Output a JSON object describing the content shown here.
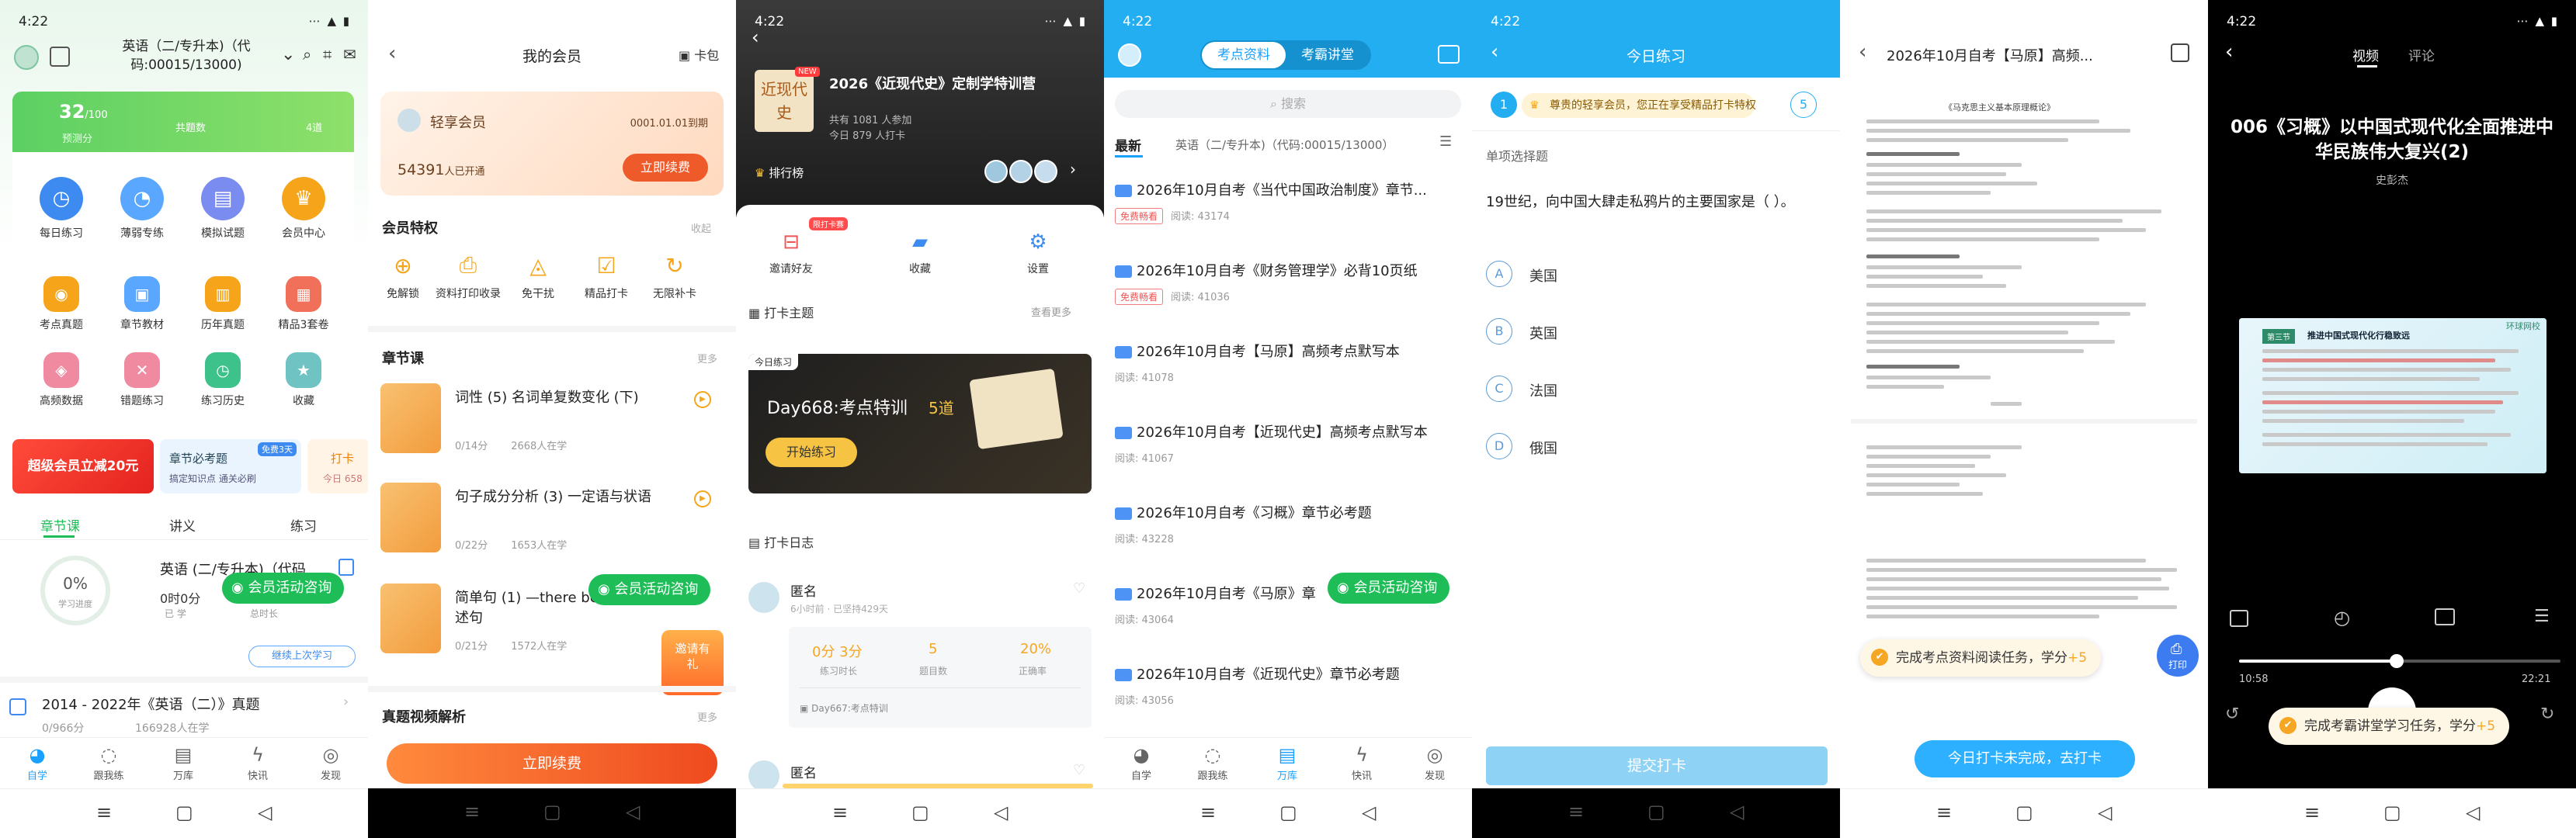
{
  "status_time": "4:22",
  "s1": {
    "title": "英语（二/专升本)（代码:00015/13000)",
    "score": "32",
    "score_sub": "/100",
    "score_lbl": "预测分",
    "c2": "共题数",
    "c3": "4道",
    "icons1": [
      "每日练习",
      "薄弱专练",
      "模拟试题",
      "会员中心"
    ],
    "icons2": [
      "考点真题",
      "章节教材",
      "历年真题",
      "精品3套卷"
    ],
    "icons3": [
      "高频数据",
      "错题练习",
      "练习历史",
      "收藏"
    ],
    "banner1": "超级会员立减20元",
    "banner2_t": "章节必考题",
    "banner2_s": "搞定知识点 通关必刷",
    "banner2_b": "免费3天",
    "banner3_t": "打卡",
    "banner3_s": "今日 658",
    "tabs": [
      "章节课",
      "讲义",
      "练习"
    ],
    "course_title": "英语 (二/专升本)（代码",
    "pct": "0%",
    "pct_lbl": "学习进度",
    "time_v": "0时0分",
    "time_l": "已 学",
    "total_l": "总时长",
    "continue": "继续上次学习",
    "item_title": "2014 - 2022年《英语（二）》真题",
    "item_meta1": "0/966分",
    "item_meta2": "166928人在学",
    "tab_items": [
      "自学",
      "跟我练",
      "万库",
      "快讯",
      "发现"
    ]
  },
  "s2": {
    "title": "我的会员",
    "card": "卡包",
    "member": "轻享会员",
    "expire": "0001.01.01到期",
    "count": "54391",
    "count_sfx": "人已开通",
    "renew": "立即续费",
    "priv_title": "会员特权",
    "priv_more": "收起",
    "privs": [
      "免解锁",
      "资料打印收录",
      "免干扰",
      "精品打卡",
      "无限补卡"
    ],
    "chap_title": "章节课",
    "chap_more": "更多",
    "lessons": [
      {
        "t": "词性 (5) 名词单复数变化 (下)",
        "a": "0/14分",
        "b": "2668人在学"
      },
      {
        "t": "句子成分分析 (3) 一定语与状语",
        "a": "0/22分",
        "b": "1653人在学"
      },
      {
        "t": "简单句 (1) —there be 述句",
        "a": "0/21分",
        "b": "1572人在学"
      }
    ],
    "gift": "邀请有礼",
    "video_title": "真题视频解析",
    "video_more": "更多",
    "btn": "立即续费"
  },
  "s3": {
    "badge": "NEW",
    "cover": "近现代史",
    "title": "2026《近现代史》定制学特训营",
    "joined": "共有 1081 人参加",
    "checked": "今日 879 人打卡",
    "rank": "排行榜",
    "acts": [
      "邀请好友",
      "收藏",
      "设置"
    ],
    "act_badge": "限打卡赛",
    "theme": "打卡主题",
    "theme_more": "查看更多",
    "card_tag": "今日练习",
    "card_title": "Day668:考点特训",
    "card_n": "5道",
    "card_btn": "开始练习",
    "log_title": "打卡日志",
    "u1": "匿名",
    "u1_sub": "6小时前 · 已坚持429天",
    "st": [
      {
        "v": "0分 3分",
        "l": "练习时长"
      },
      {
        "v": "5",
        "l": "题目数"
      },
      {
        "v": "20%",
        "l": "正确率"
      }
    ],
    "u1_task": "Day667:考点特训",
    "u2": "匿名"
  },
  "s4": {
    "tabs": [
      "考点资料",
      "考霸讲堂"
    ],
    "search": "搜索",
    "filter1": "最新",
    "filter2": "英语（二/专升本)（代码:00015/13000）",
    "arts": [
      {
        "t": "2026年10月自考《当代中国政治制度》章节...",
        "free": "免费畅看",
        "r": "阅读: 43174"
      },
      {
        "t": "2026年10月自考《财务管理学》必背10页纸",
        "free": "免费畅看",
        "r": "阅读: 41036"
      },
      {
        "t": "2026年10月自考【马原】高频考点默写本",
        "free": "",
        "r": "阅读: 41078"
      },
      {
        "t": "2026年10月自考【近现代史】高频考点默写本",
        "free": "",
        "r": "阅读: 41067"
      },
      {
        "t": "2026年10月自考《习概》章节必考题",
        "free": "",
        "r": "阅读: 43228"
      },
      {
        "t": "2026年10月自考《马原》章节必考题",
        "free": "",
        "r": "阅读: 43064"
      },
      {
        "t": "2026年10月自考《近现代史》章节必考题",
        "free": "",
        "r": "阅读: 43056"
      }
    ]
  },
  "s5": {
    "title": "今日练习",
    "notice": "尊贵的轻享会员，您正在享受精品打卡特权",
    "progress_n": "5",
    "qtype": "单项选择题",
    "q": "19世纪，向中国大肆走私鸦片的主要国家是（  ）。",
    "opts": [
      {
        "k": "A",
        "v": "美国"
      },
      {
        "k": "B",
        "v": "英国"
      },
      {
        "k": "C",
        "v": "法国"
      },
      {
        "k": "D",
        "v": "俄国"
      }
    ],
    "submit": "提交打卡"
  },
  "s6": {
    "title": "2026年10月自考【马原】高频...",
    "doc_head": "《马克思主义基本原理概论》",
    "task": "完成考点资料阅读任务，学分",
    "task_pts": "+5",
    "print": "打印",
    "bar": "今日打卡未完成，去打卡"
  },
  "s7": {
    "tabs": [
      "视频",
      "评论"
    ],
    "title": "006《习概》以中国式现代化全面推进中华民族伟大复兴(2)",
    "teacher": "史彭杰",
    "slide_tag": "第三节",
    "slide_title": "推进中国式现代化行稳致远",
    "logo": "环球网校",
    "t_cur": "10:58",
    "t_end": "22:21",
    "progress": 0.49,
    "task": "完成考霸讲堂学习任务，学分",
    "task_pts": "+5"
  },
  "consult": "会员活动咨询"
}
